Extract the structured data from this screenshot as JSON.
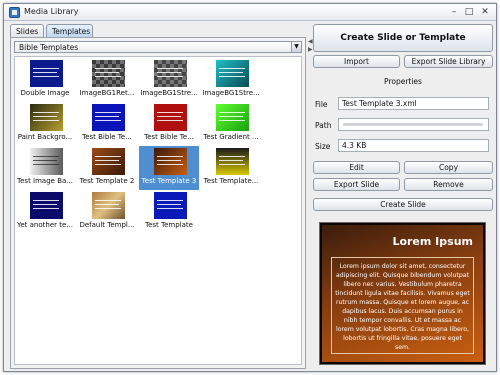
{
  "window": {
    "title": "Media Library"
  },
  "tabs": [
    {
      "label": "Slides"
    },
    {
      "label": "Templates"
    }
  ],
  "template_filter": {
    "selected": "Bible Templates"
  },
  "templates": [
    {
      "label": "Double Image"
    },
    {
      "label": "ImageBG1Ret..."
    },
    {
      "label": "ImageBG1Stre..."
    },
    {
      "label": "ImageBG1Stre..."
    },
    {
      "label": "Paint Backgro..."
    },
    {
      "label": "Test Bible Te..."
    },
    {
      "label": "Test Bible Te..."
    },
    {
      "label": "Test Gradient ..."
    },
    {
      "label": "Test Image Ba..."
    },
    {
      "label": "Test Template 2"
    },
    {
      "label": "Test Template 3"
    },
    {
      "label": "Test Template..."
    },
    {
      "label": "Yet another te..."
    },
    {
      "label": "Default Templ..."
    },
    {
      "label": "Test Template"
    }
  ],
  "actions": {
    "create": "Create Slide or Template",
    "import": "Import",
    "export_library": "Export Slide Library",
    "properties": "Properties",
    "edit": "Edit",
    "copy": "Copy",
    "export_slide": "Export Slide",
    "remove": "Remove",
    "create_slide": "Create Slide"
  },
  "properties": {
    "file_label": "File",
    "file_value": "Test Template 3.xml",
    "path_label": "Path",
    "size_label": "Size",
    "size_value": "4.3 KB"
  },
  "preview": {
    "title": "Lorem Ipsum",
    "body": "Lorem ipsum dolor sit amet, consectetur adipiscing elit. Quisque bibendum volutpat libero nec varius. Vestibulum pharetra tincidunt ligula vitae facilisis. Vivamus eget rutrum massa. Quisque et lorem augue, ac dapibus lacus. Duis accumsan purus in nibh tempor convallis. Ut et massa ac lorem volutpat lobortis. Cras magna libero, lobortis ut fringilla vitae, posuere eget sem."
  }
}
